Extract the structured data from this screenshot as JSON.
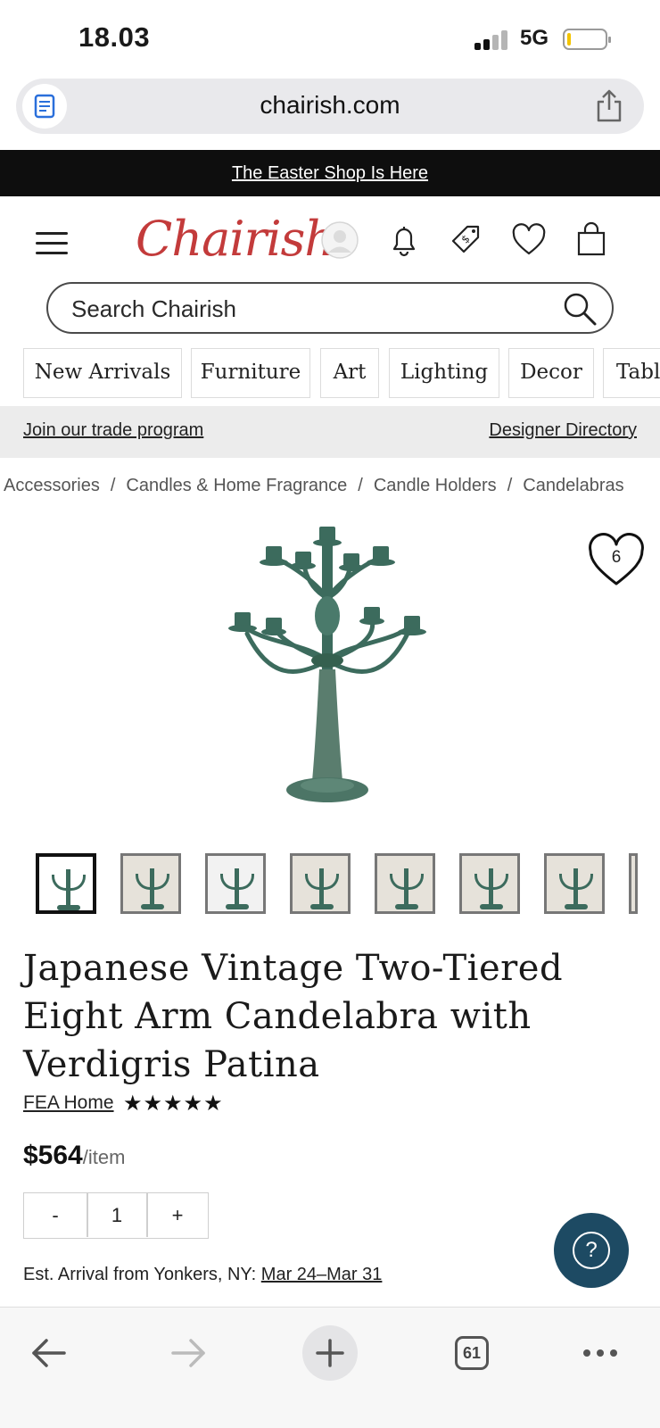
{
  "status_bar": {
    "time": "18.03",
    "network": "5G"
  },
  "browser": {
    "url": "chairish.com"
  },
  "promo": {
    "text": "The Easter Shop Is Here"
  },
  "header": {
    "logo": "Chairish"
  },
  "search": {
    "placeholder": "Search Chairish"
  },
  "categories": [
    "New Arrivals",
    "Furniture",
    "Art",
    "Lighting",
    "Decor",
    "Tabl"
  ],
  "trade_bar": {
    "left_link": "Join our trade program",
    "right_link": "Designer Directory"
  },
  "breadcrumb": [
    "Accessories",
    "Candles & Home Fragrance",
    "Candle Holders",
    "Candelabras"
  ],
  "breadcrumb_separator": "/",
  "product": {
    "favorite_count": "6",
    "title": "Japanese Vintage Two-Tiered Eight Arm Candelabra with Verdigris Patina",
    "seller": "FEA Home",
    "rating": "★★★★★",
    "price": "$564",
    "price_unit": "/item",
    "quantity": "1",
    "qty_minus": "-",
    "qty_plus": "+",
    "arrival_label": "Est. Arrival from Yonkers, NY:",
    "arrival_dates": "Mar 24–Mar 31"
  },
  "help": {
    "label": "?"
  },
  "toolbar": {
    "tab_count": "61"
  },
  "colors": {
    "logo": "#c33b3b",
    "promo_bg": "#0e0e0e",
    "help_bg": "#1d4a63",
    "verdigris": "#3c6b5d"
  }
}
